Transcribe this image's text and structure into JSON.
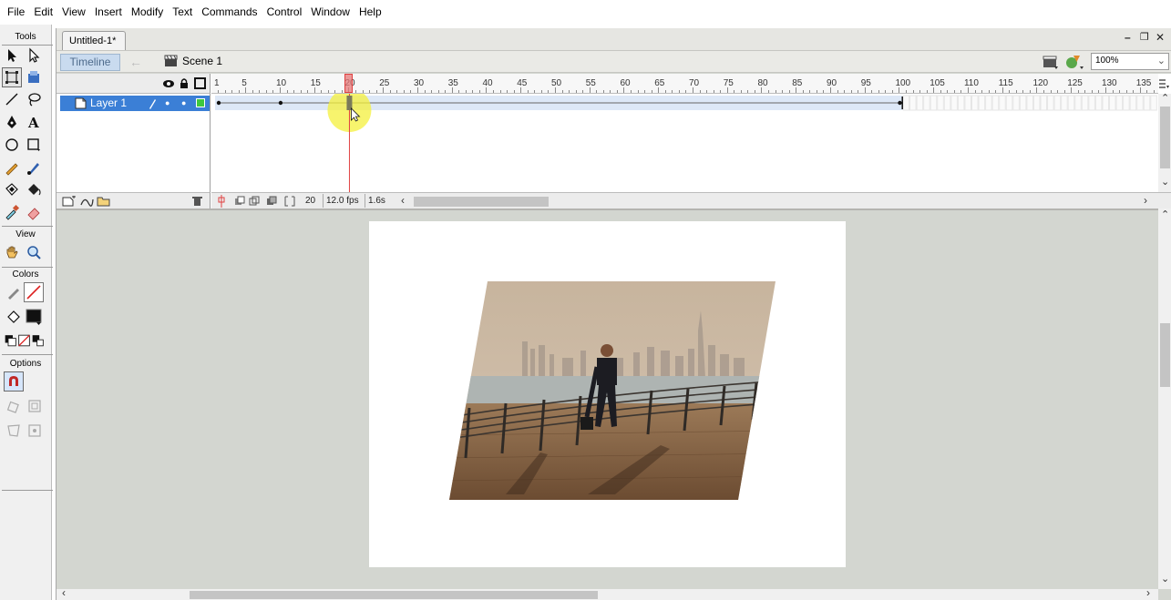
{
  "menu": [
    "File",
    "Edit",
    "View",
    "Insert",
    "Modify",
    "Text",
    "Commands",
    "Control",
    "Window",
    "Help"
  ],
  "tools": {
    "title": "Tools",
    "view_label": "View",
    "colors_label": "Colors",
    "options_label": "Options"
  },
  "document": {
    "tab_title": "Untitled-1*",
    "timeline_button": "Timeline",
    "scene_name": "Scene 1",
    "zoom": "100%"
  },
  "timeline": {
    "layer_name": "Layer 1",
    "ruler_numbers": [
      "1",
      "5",
      "10",
      "15",
      "20",
      "25",
      "30",
      "35",
      "40",
      "45",
      "50",
      "55",
      "60",
      "65",
      "70",
      "75",
      "80",
      "85",
      "90",
      "95",
      "100",
      "105",
      "110",
      "115",
      "120",
      "125",
      "130",
      "135"
    ],
    "current_frame": "20",
    "frame_rate": "12.0 fps",
    "elapsed_time": "1.6s",
    "playhead_frame": 20,
    "tween_end_frame": 100
  },
  "colors": {
    "layer_highlight": "#3b7fd6",
    "playhead": "#e04040",
    "timeline_button_bg": "#c9dbef",
    "stage": "#ffffff",
    "pasteboard": "#d3d6d0",
    "cursor_highlight": "#f4f03c"
  }
}
